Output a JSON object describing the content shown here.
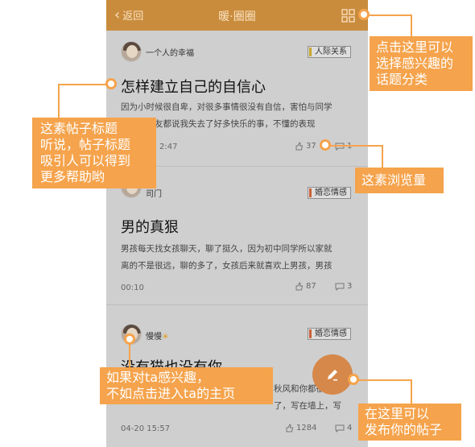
{
  "navbar": {
    "back_label": "返回",
    "title": "暖·圈圈",
    "grid_icon": "grid-icon"
  },
  "posts": [
    {
      "username": "一个人的幸福",
      "tag": "人际关系",
      "tag_color": "#c7a62a",
      "title": "怎样建立自己的自信心",
      "excerpt_lines": [
        "因为小时候很自卑，对很多事情很没有自信，害怕与同学",
        "交流，朋友都说我失去了好多快乐的事，不懂的表现"
      ],
      "time": "2:47",
      "likes": "37",
      "comments": "1"
    },
    {
      "username": "司门",
      "tag": "婚恋情感",
      "tag_color": "#c9623a",
      "title": "男的真狠",
      "excerpt_lines": [
        "男孩每天找女孩聊天，聊了挺久，因为初中同学所以家就",
        "离的不是很远，聊的多了，女孩后来就喜欢上男孩，男孩"
      ],
      "time": "00:10",
      "likes": "87",
      "comments": "3"
    },
    {
      "username": "慢慢",
      "username_emoji": "☀",
      "tag": "婚恋情感",
      "tag_color": "#c9623a",
      "title": "没有猫也没有你",
      "excerpt_lines": [
        "秋风和你都很温",
        "了，写在墙上，写"
      ],
      "time": "04-20 15:57",
      "likes": "1284",
      "comments": "4"
    }
  ],
  "fab_icon": "pencil-icon",
  "callouts": {
    "grid": [
      "点击这里可以",
      "选择感兴趣的",
      "话题分类"
    ],
    "title": [
      "这素帖子标题",
      "听说，帖子标题",
      "吸引人可以得到",
      "更多帮助哟"
    ],
    "views": [
      "这素浏览量"
    ],
    "avatar": [
      "如果对ta感兴趣，",
      "不如点击进入ta的主页"
    ],
    "publish": [
      "在这里可以",
      "发布你的帖子"
    ]
  },
  "colors": {
    "navbar": "#c98c3c",
    "callout": "#f5a34c",
    "fab": "#d6884a"
  }
}
